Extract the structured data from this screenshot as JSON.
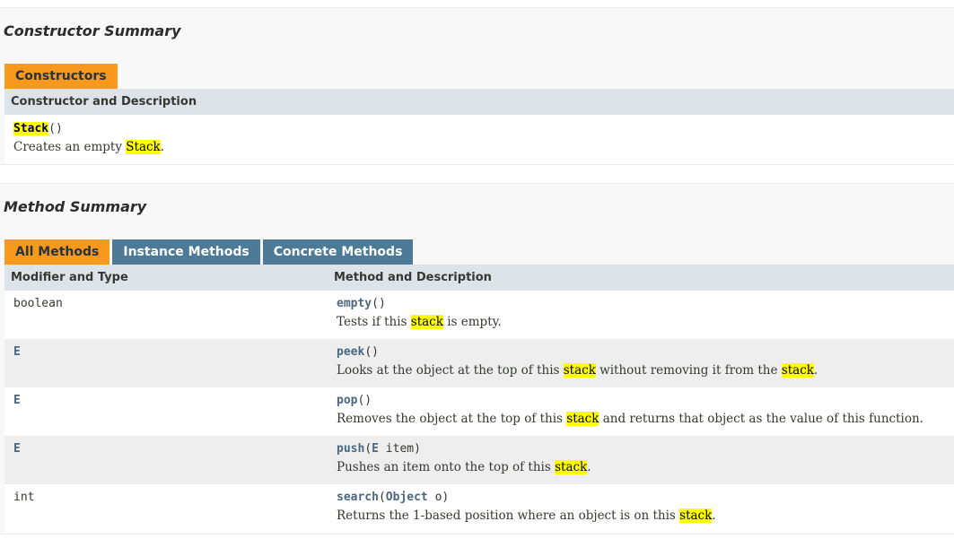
{
  "constructor_summary": {
    "title": "Constructor Summary",
    "tab_label": "Constructors",
    "header": "Constructor and Description",
    "row": {
      "name": "Stack",
      "signature": "()",
      "desc_before": "Creates an empty ",
      "desc_highlight": "Stack",
      "desc_after": "."
    }
  },
  "method_summary": {
    "title": "Method Summary",
    "tabs": [
      {
        "label": "All Methods"
      },
      {
        "label": "Instance Methods"
      },
      {
        "label": "Concrete Methods"
      }
    ],
    "headers": {
      "col1": "Modifier and Type",
      "col2": "Method and Description"
    },
    "rows": [
      {
        "type": "boolean",
        "name": "empty",
        "params": "()",
        "desc_1": "Tests if this ",
        "hl_1": "stack",
        "desc_2": " is empty.",
        "hl_2": "",
        "desc_3": ""
      },
      {
        "type": "E",
        "name": "peek",
        "params": "()",
        "desc_1": "Looks at the object at the top of this ",
        "hl_1": "stack",
        "desc_2": " without removing it from the ",
        "hl_2": "stack",
        "desc_3": "."
      },
      {
        "type": "E",
        "name": "pop",
        "params": "()",
        "desc_1": "Removes the object at the top of this ",
        "hl_1": "stack",
        "desc_2": " and returns that object as the value of this function.",
        "hl_2": "",
        "desc_3": ""
      },
      {
        "type": "E",
        "name": "push",
        "params_open": "(",
        "param_type": "E",
        "params_rest": " item)",
        "desc_1": "Pushes an item onto the top of this ",
        "hl_1": "stack",
        "desc_2": ".",
        "hl_2": "",
        "desc_3": ""
      },
      {
        "type": "int",
        "name": "search",
        "params_open": "(",
        "param_type": "Object",
        "params_rest": " o)",
        "desc_1": "Returns the 1-based position where an object is on this ",
        "hl_1": "stack",
        "desc_2": ".",
        "hl_2": "",
        "desc_3": ""
      }
    ]
  },
  "colors": {
    "active_tab": "#f8981d",
    "inactive_tab": "#4d7a97",
    "header_bg": "#dee3e9",
    "alt_row_bg": "#eeeeef",
    "highlight": "#ffff00",
    "link": "#4a6782"
  }
}
